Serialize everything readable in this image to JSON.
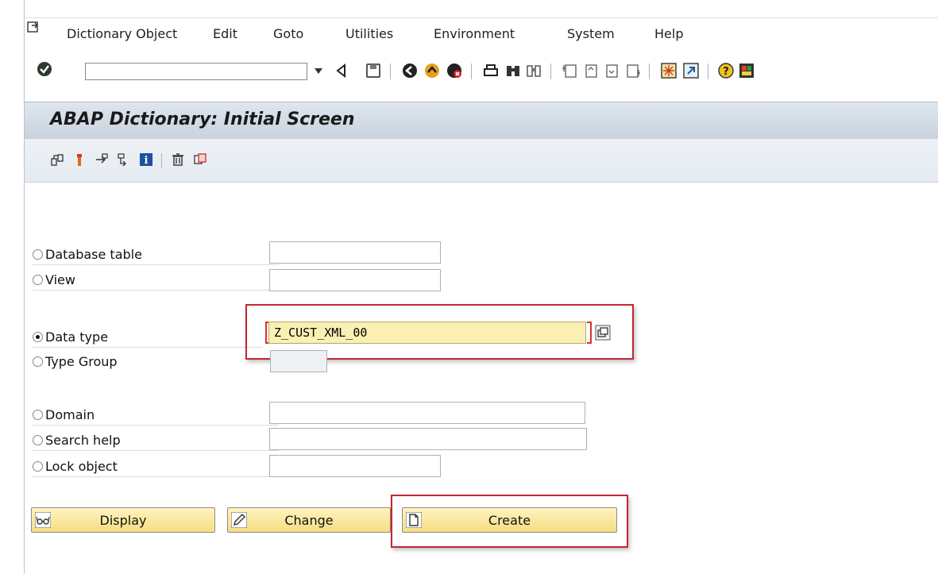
{
  "menu": {
    "items": [
      "Dictionary Object",
      "Edit",
      "Goto",
      "Utilities",
      "Environment",
      "System",
      "Help"
    ]
  },
  "toolbar": {
    "command_field_value": "",
    "icons": [
      "enter-icon",
      "back-arrow-icon",
      "save-icon",
      "back-icon",
      "exit-icon",
      "cancel-icon",
      "print-icon",
      "find-icon",
      "find-next-icon",
      "first-page-icon",
      "previous-page-icon",
      "next-page-icon",
      "last-page-icon",
      "create-session-icon",
      "shortcut-icon",
      "help-icon",
      "layout-icon"
    ]
  },
  "title": "ABAP Dictionary: Initial Screen",
  "app_toolbar": {
    "icons": [
      "other-object-icon",
      "check-icon",
      "activate-icon",
      "where-used-icon",
      "information-icon",
      "delete-icon",
      "copy-icon"
    ]
  },
  "form": {
    "options": [
      {
        "label": "Database table",
        "value": "",
        "checked": false
      },
      {
        "label": "View",
        "value": "",
        "checked": false
      },
      {
        "label": "Data type",
        "value": "Z_CUST_XML_00",
        "checked": true
      },
      {
        "label": "Type Group",
        "value": "",
        "checked": false
      },
      {
        "label": "Domain",
        "value": "",
        "checked": false
      },
      {
        "label": "Search help",
        "value": "",
        "checked": false
      },
      {
        "label": "Lock object",
        "value": "",
        "checked": false
      }
    ]
  },
  "buttons": {
    "display": "Display",
    "change": "Change",
    "create": "Create"
  },
  "colors": {
    "title_bar": "#d3dce5",
    "button_fill": "#f8e39a",
    "active_field": "#fbf0b4",
    "highlight_border": "#c0272f",
    "required_marker": "#d9322b"
  }
}
